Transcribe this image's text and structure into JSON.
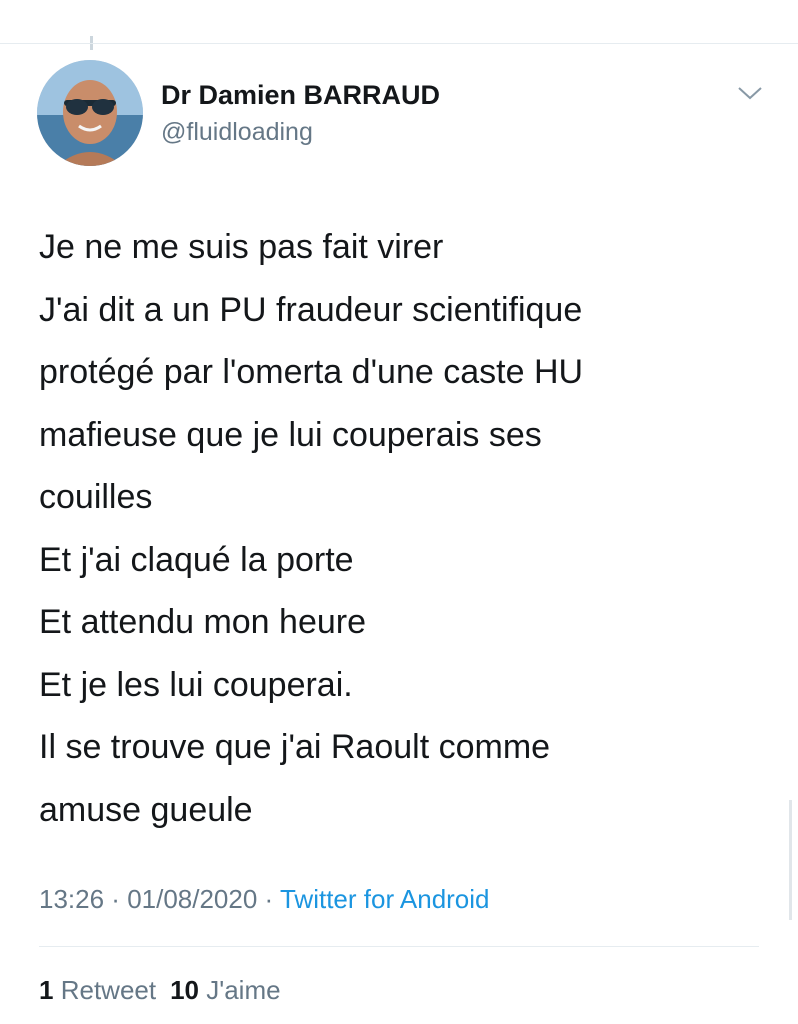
{
  "tweet": {
    "author": {
      "display_name": "Dr Damien BARRAUD",
      "handle": "@fluidloading"
    },
    "text_lines": [
      "Je ne me suis pas fait virer",
      "J'ai dit a un PU fraudeur scientifique",
      "protégé par l'omerta d'une caste HU",
      "mafieuse que je lui couperais ses",
      "couilles",
      "Et j'ai claqué la porte",
      "Et attendu mon heure",
      "Et je les lui couperai.",
      "Il se trouve que j'ai Raoult comme",
      "amuse gueule"
    ],
    "time": "13:26",
    "separator": " · ",
    "date": "01/08/2020",
    "source": "Twitter for Android",
    "retweet_count": "1",
    "retweet_label": "Retweet",
    "like_count": "10",
    "like_label": "J'aime"
  },
  "icons": {
    "menu": "chevron-down-icon",
    "avatar": "profile-photo"
  },
  "colors": {
    "text": "#14171a",
    "secondary": "#657786",
    "link": "#1b95e0",
    "border": "#e6ecf0"
  }
}
